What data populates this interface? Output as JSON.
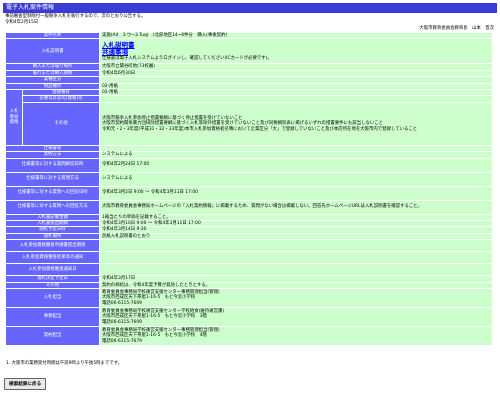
{
  "title": "電子入札案件情報",
  "intro": [
    "事前審査型制限付一般競争入札を執行するので、次のとおり公告する。",
    "令和4年2月15日"
  ],
  "publisher": "大阪市教育委員会教育長　山本　晋次",
  "rows": {
    "project_name": {
      "label": "案件名称",
      "value": "実施(A4　3.ウ~3.Tuq)　(北部地区14~6件分　購入(事後契約)"
    },
    "bid_method": {
      "label": "入札説明書",
      "link1": "入札説明書",
      "link2": "共通事項",
      "note": "仕様書は電子入札システムよりログインし、確認してください(ICカードが必要です)。"
    },
    "delivery_place": {
      "label": "納入または履行場所",
      "value": "大阪市立関谷町他(73校園)"
    },
    "delivery_period": {
      "label": "履行または納入期限",
      "value": "令和4年6月30日"
    },
    "category": {
      "label": "業種区分",
      "value": ""
    },
    "item_class": {
      "label": "物品種目",
      "value": "02-用紙"
    },
    "eligibility": {
      "group_label": "入札参加資格",
      "registered_label": "登録種目",
      "registered_value": "02-用紙",
      "required_label": "必要な許認可(資格)等",
      "required_value": "",
      "other_label": "その他",
      "other_value": "大阪市競争入札参加停止措置要綱に基づく停止措置を受けていないこと\n大阪市契約関係暴力団排除措置要綱に基づく入札等除外措置を受けていないこと及び同要綱別表に掲げるいずれの措置要件にも該当しないこと\n令和元・2・3年度(平成31・32・33年度)本市入札参加資格者名簿において企業区分「大」で登録していないこと及び本店所在地を大阪市内で登録していること"
    },
    "bid_system": {
      "label": "仕様書等",
      "value": ""
    },
    "bid_form": {
      "label": "契約方法",
      "value": "システムによる"
    },
    "q_deadline": {
      "label": "仕様書等に対する質問締切日時",
      "value": "令和4年2月24日 17:00"
    },
    "q_submit": {
      "label": "仕様書等に対する質問方法",
      "value": "システムによる"
    },
    "answer_date": {
      "label": "仕様書等に対する質問への回答日時",
      "value": "令和4年3月2日 9:00 ～ 令和4年3月11日 17:00"
    },
    "answer_method": {
      "label": "仕様書等に対する質問への回答方法",
      "value": "大阪市教育委員会事務局ホームページの「入札契約情報」に掲載するため、質問がない場合は掲載しない。回答先ホームページURLは入札説明書を確認すること。"
    },
    "deposit": {
      "label": "入札書記載金額",
      "value": "1箱当たりの単価を記載すること。"
    },
    "bid_period": {
      "label": "入札書提出期間",
      "value": "令和4年3月10日 9:00 ～ 令和4年3月11日 17:00"
    },
    "open_date": {
      "label": "開札予定日時",
      "value": "令和4年3月14日 9:30"
    },
    "open_place": {
      "label": "開札場所",
      "value": "別紙入札説明書のとおり"
    },
    "blank1": {
      "label": "入札参加資格審査申請書提出期限",
      "value": ""
    },
    "blank2": {
      "label": "入札参加資格審査結果等の通知",
      "value": ""
    },
    "blank3": {
      "label": "入札参加資格審査通知日",
      "value": ""
    },
    "blank4": {
      "label": "落札決定予定日",
      "value": "令和4年3月17日"
    },
    "contract": {
      "label": "その他",
      "value": "契約の締結は、令和4年度予算が発効したときとする。"
    },
    "contact_bid": {
      "label": "入札担当",
      "value": "教育委員会事務局学校運営支援センター事務管理担当(管理)\n大阪市西成区天下茶屋1-16-5　もと今宮小学校\n電話06-6115-7609"
    },
    "contact_office": {
      "label": "事務担当",
      "value": "教育委員会事務局学校運営支援センター学校給食(維持運営課)\n大阪市西成区天下茶屋1-16-5　もと今宮小学校　3階\n電話06-6115-7609"
    },
    "contact_contract": {
      "label": "契約担当",
      "value": "教育委員会事務局学校運営支援センター事務管理担当(管理)\n大阪市西成区天下茶屋1-16-5　もと今宮小学校　4階\n電話06-6115-7679"
    }
  },
  "note": "1. 大阪市の業務受付時間は午前9時より午後5時までです。",
  "back_button": "検索結果に戻る"
}
